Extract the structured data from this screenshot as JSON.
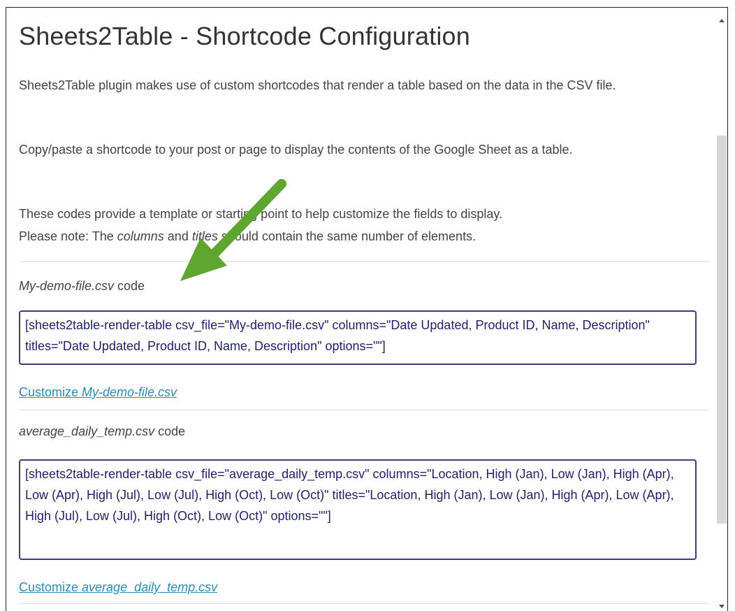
{
  "page": {
    "title": "Sheets2Table - Shortcode Configuration",
    "intro_1": "Sheets2Table plugin makes use of custom shortcodes that render a table based on the data in the CSV file.",
    "intro_2": "Copy/paste a shortcode to your post or page to display the contents of the Google Sheet as a table.",
    "intro_3_line1": "These codes provide a template or starting point to help customize the fields to display.",
    "intro_3_line2_pre": "Please note: The ",
    "intro_3_columns": "columns",
    "intro_3_and": " and ",
    "intro_3_titles": "titles",
    "intro_3_line2_post": " should contain the same number of elements."
  },
  "files": [
    {
      "filename": "My-demo-file.csv",
      "label_suffix": " code",
      "shortcode": "[sheets2table-render-table csv_file=\"My-demo-file.csv\" columns=\"Date Updated, Product ID, Name, Description\" titles=\"Date Updated, Product ID, Name, Description\" options=\"\"]",
      "customize_prefix": "Customize "
    },
    {
      "filename": "average_daily_temp.csv",
      "label_suffix": " code",
      "shortcode": "[sheets2table-render-table csv_file=\"average_daily_temp.csv\" columns=\"Location, High (Jan), Low (Jan), High (Apr), Low (Apr), High (Jul), Low (Jul), High (Oct), Low (Oct)\" titles=\"Location, High (Jan), Low (Jan), High (Apr), Low (Apr), High (Jul), Low (Jul), High (Oct), Low (Oct)\" options=\"\"]",
      "customize_prefix": "Customize "
    }
  ],
  "colors": {
    "link": "#2e8bb8",
    "codebox_border": "#3c3a80",
    "annotation_arrow": "#5ea62f"
  },
  "icons": [
    "scroll-up-icon",
    "scroll-down-icon",
    "annotation-arrow-icon"
  ]
}
